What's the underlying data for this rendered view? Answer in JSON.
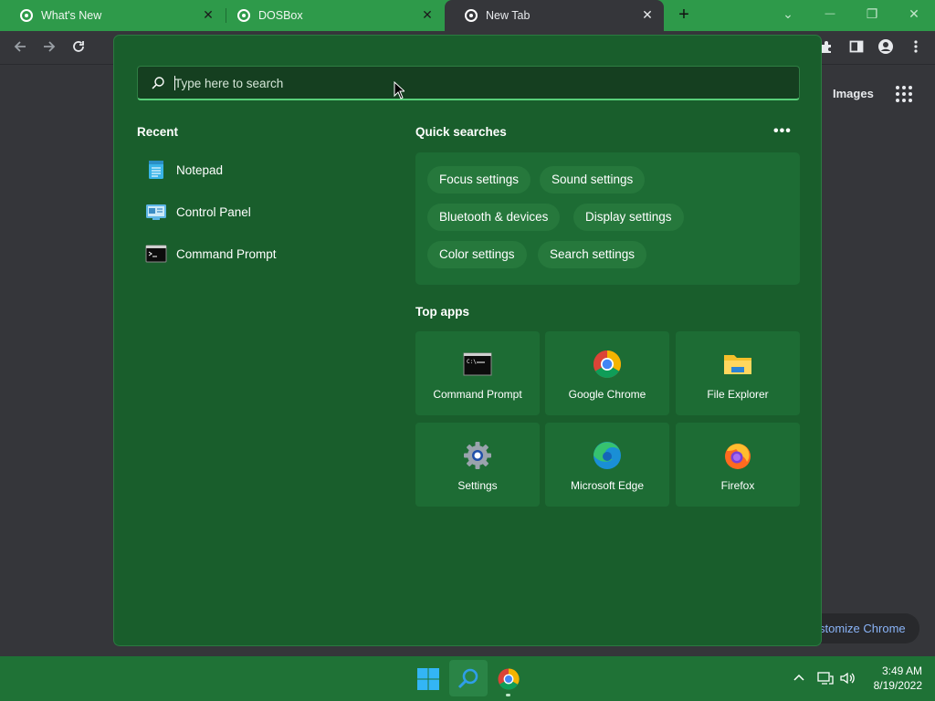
{
  "browser": {
    "tabs": [
      {
        "title": "What's New",
        "close": "✕"
      },
      {
        "title": "DOSBox",
        "close": "✕"
      },
      {
        "title": "New Tab",
        "close": "✕"
      }
    ],
    "new_tab_glyph": "+",
    "window_controls": {
      "dropdown": "⌄",
      "minimize": "—",
      "restore": "❐",
      "close": "✕"
    },
    "toolbar_icons": [
      "back-icon",
      "forward-icon",
      "reload-icon",
      "extensions-icon",
      "side-panel-icon",
      "profile-icon",
      "menu-icon"
    ],
    "images_link": "Images",
    "customize_button": "stomize Chrome"
  },
  "start_menu": {
    "search": {
      "placeholder": "Type here to search",
      "value": ""
    },
    "recent": {
      "title": "Recent",
      "items": [
        {
          "label": "Notepad",
          "icon": "notepad-icon"
        },
        {
          "label": "Control Panel",
          "icon": "control-panel-icon"
        },
        {
          "label": "Command Prompt",
          "icon": "command-prompt-icon"
        }
      ]
    },
    "quick_searches": {
      "title": "Quick searches",
      "more": "•••",
      "chips": [
        "Focus settings",
        "Sound settings",
        "Bluetooth & devices",
        "Display settings",
        "Color settings",
        "Search settings"
      ]
    },
    "top_apps": {
      "title": "Top apps",
      "apps": [
        {
          "label": "Command Prompt",
          "icon": "command-prompt-icon"
        },
        {
          "label": "Google Chrome",
          "icon": "chrome-icon"
        },
        {
          "label": "File Explorer",
          "icon": "file-explorer-icon"
        },
        {
          "label": "Settings",
          "icon": "settings-gear-icon"
        },
        {
          "label": "Microsoft Edge",
          "icon": "edge-icon"
        },
        {
          "label": "Firefox",
          "icon": "firefox-icon"
        }
      ]
    }
  },
  "taskbar": {
    "pinned": [
      "windows-start-icon",
      "search-icon",
      "chrome-icon"
    ],
    "tray": {
      "chevron": "^",
      "network": "network-icon",
      "volume": "volume-icon"
    },
    "clock": {
      "time": "3:49 AM",
      "date": "8/19/2022"
    }
  },
  "colors": {
    "tab_strip": "#2e9a4a",
    "flyout_bg": "#195e2c",
    "tile_bg": "#1d6c34",
    "search_accent": "#58d07a",
    "taskbar": "#1f7236"
  }
}
